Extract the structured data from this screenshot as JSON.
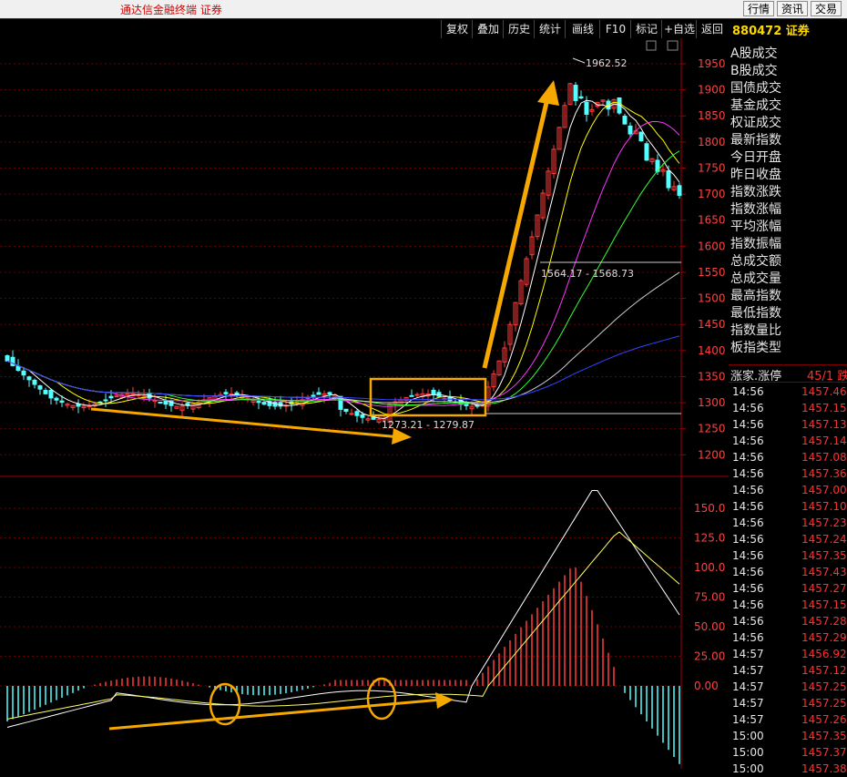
{
  "titlebar": {
    "app_title": "通达信金融终端  证券",
    "buttons": [
      "行情",
      "资讯",
      "交易"
    ]
  },
  "toolbar": {
    "buttons": [
      "复权",
      "叠加",
      "历史",
      "统计",
      "画线",
      "F10",
      "标记",
      "+自选",
      "返回"
    ],
    "code_label": "880472 证券"
  },
  "price_axis": {
    "ticks": [
      "1950",
      "1900",
      "1850",
      "1800",
      "1750",
      "1700",
      "1650",
      "1600",
      "1550",
      "1500",
      "1450",
      "1400",
      "1350",
      "1300",
      "1250",
      "1200"
    ]
  },
  "macd_axis": {
    "ticks": [
      "150.0",
      "125.0",
      "100.0",
      "75.00",
      "50.00",
      "25.00",
      "0.00"
    ]
  },
  "annotations": {
    "high_label": "1962.52",
    "gap_label": "1564.17 - 1568.73",
    "box_label": "1273.21 - 1279.87"
  },
  "side_menu": [
    "A股成交",
    "B股成交",
    "国债成交",
    "基金成交",
    "权证成交",
    "最新指数",
    "今日开盘",
    "昨日收盘",
    "指数涨跌",
    "指数涨幅",
    "平均涨幅",
    "指数振幅",
    "总成交额",
    "总成交量",
    "最高指数",
    "最低指数",
    "指数量比",
    "板指类型"
  ],
  "stat": {
    "label": "涨家.涨停",
    "value": "45/1 跌"
  },
  "ticks": [
    {
      "time": "14:56",
      "price": "1457.46"
    },
    {
      "time": "14:56",
      "price": "1457.15"
    },
    {
      "time": "14:56",
      "price": "1457.13"
    },
    {
      "time": "14:56",
      "price": "1457.14"
    },
    {
      "time": "14:56",
      "price": "1457.08"
    },
    {
      "time": "14:56",
      "price": "1457.36"
    },
    {
      "time": "14:56",
      "price": "1457.00"
    },
    {
      "time": "14:56",
      "price": "1457.10"
    },
    {
      "time": "14:56",
      "price": "1457.23"
    },
    {
      "time": "14:56",
      "price": "1457.24"
    },
    {
      "time": "14:56",
      "price": "1457.35"
    },
    {
      "time": "14:56",
      "price": "1457.43"
    },
    {
      "time": "14:56",
      "price": "1457.27"
    },
    {
      "time": "14:56",
      "price": "1457.15"
    },
    {
      "time": "14:56",
      "price": "1457.28"
    },
    {
      "time": "14:56",
      "price": "1457.29"
    },
    {
      "time": "14:57",
      "price": "1456.92"
    },
    {
      "time": "14:57",
      "price": "1457.12"
    },
    {
      "time": "14:57",
      "price": "1457.25"
    },
    {
      "time": "14:57",
      "price": "1457.25"
    },
    {
      "time": "14:57",
      "price": "1457.26"
    },
    {
      "time": "15:00",
      "price": "1457.35"
    },
    {
      "time": "15:00",
      "price": "1457.37"
    },
    {
      "time": "15:00",
      "price": "1457.38"
    }
  ],
  "colors": {
    "up": "#ff3b3b",
    "down": "#54ffff",
    "highlight": "#f5a800"
  }
}
